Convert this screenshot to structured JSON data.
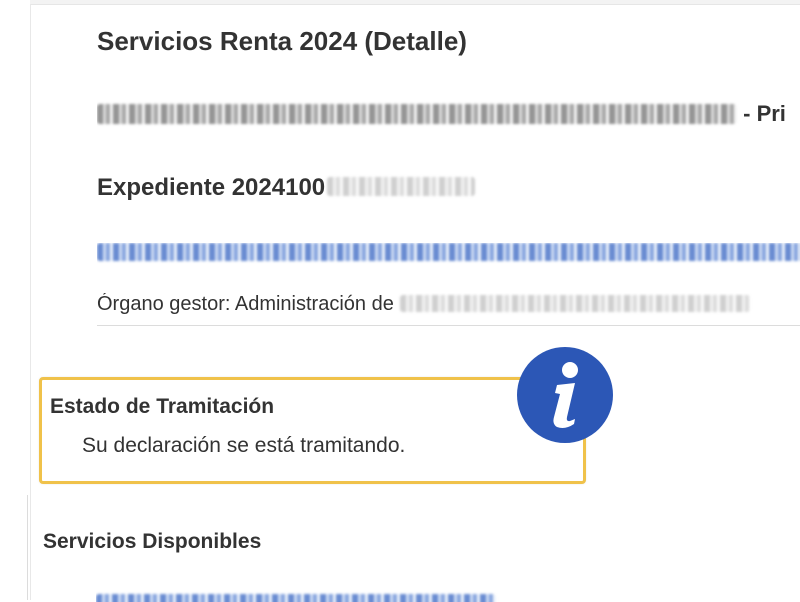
{
  "header": {
    "title": "Servicios Renta 2024 (Detalle)"
  },
  "procedure": {
    "suffix": "- Pri"
  },
  "expediente": {
    "label": "Expediente 2024100"
  },
  "organo": {
    "label": "Órgano gestor: Administración de"
  },
  "status": {
    "title": "Estado de Tramitación",
    "message": "Su declaración se está tramitando.",
    "accent_color": "#f0c24a",
    "icon": "info-icon",
    "icon_color": "#2c57b6"
  },
  "services": {
    "heading": "Servicios Disponibles"
  },
  "colors": {
    "text": "#333333",
    "link": "#2f64c2"
  }
}
